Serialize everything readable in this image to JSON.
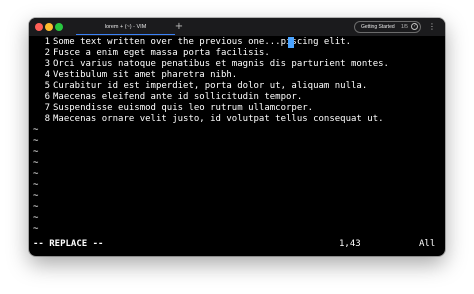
{
  "window": {
    "tab_title": "lorem + (~) - VIM",
    "new_tab_symbol": "+",
    "help": {
      "title": "Getting Started",
      "progress": "1/5",
      "icon_glyph": "?"
    },
    "more_glyph": "⋮"
  },
  "editor": {
    "lines": [
      {
        "num": "1",
        "text": "Some text written over the previous one...piscing elit."
      },
      {
        "num": "2",
        "text": "Fusce a enim eget massa porta facilisis."
      },
      {
        "num": "3",
        "text": "Orci varius natoque penatibus et magnis dis parturient montes."
      },
      {
        "num": "4",
        "text": "Vestibulum sit amet pharetra nibh."
      },
      {
        "num": "5",
        "text": "Curabitur id est imperdiet, porta dolor ut, aliquam nulla."
      },
      {
        "num": "6",
        "text": "Maecenas eleifend ante id sollicitudin tempor."
      },
      {
        "num": "7",
        "text": "Suspendisse euismod quis leo rutrum ullamcorper."
      },
      {
        "num": "8",
        "text": "Maecenas ornare velit justo, id volutpat tellus consequat ut."
      }
    ],
    "empty_marker": "~"
  },
  "status": {
    "mode": "-- REPLACE --",
    "position": "1,43",
    "scroll": "All"
  },
  "colors": {
    "background": "#000000",
    "titlebar": "#1b1b1d",
    "cursor": "#4aa3ff",
    "tab_accent": "#3b82f6"
  }
}
